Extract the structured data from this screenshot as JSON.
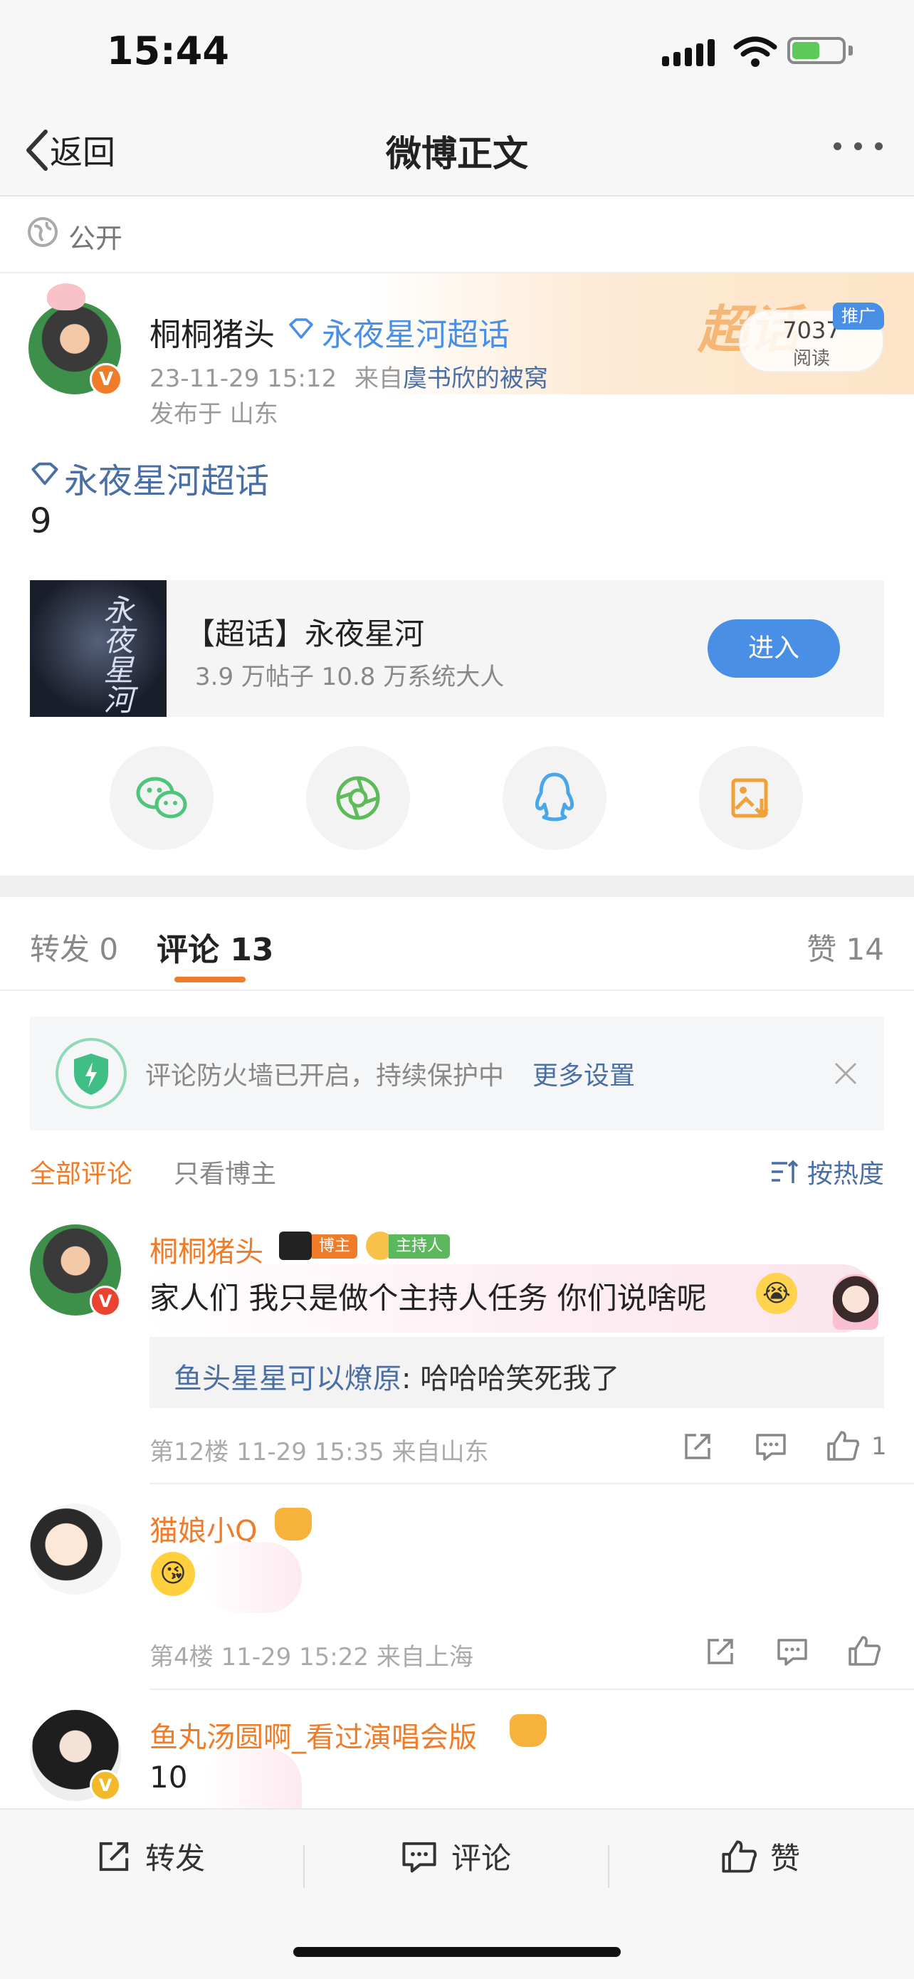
{
  "status_bar": {
    "time": "15:44"
  },
  "nav": {
    "back_label": "返回",
    "title": "微博正文"
  },
  "visibility": {
    "label": "公开"
  },
  "post": {
    "author": "桐桐猪头",
    "topic_tag": "永夜星河超话",
    "datetime": "23-11-29 15:12",
    "source_prefix": "来自",
    "source": "虞书欣的被窝",
    "location": "发布于 山东",
    "read_count": "7037",
    "read_label": "阅读",
    "promo_badge": "推广",
    "body_tag": "永夜星河超话",
    "body_text": "9"
  },
  "supertopic_card": {
    "title": "【超话】永夜星河",
    "stats": "3.9 万帖子 10.8 万系统大人",
    "enter_label": "进入",
    "cover_text": "永夜星河"
  },
  "share_buttons": [
    {
      "icon": "wechat-icon",
      "color": "#4fc47a"
    },
    {
      "icon": "moments-icon",
      "color": "#5dbb5a"
    },
    {
      "icon": "qq-icon",
      "color": "#49a6e8"
    },
    {
      "icon": "save-image-icon",
      "color": "#f0a23a"
    }
  ],
  "tabs": {
    "repost": "转发 0",
    "comment": "评论 13",
    "like": "赞 14"
  },
  "firewall": {
    "text": "评论防火墙已开启，持续保护中",
    "link": "更多设置"
  },
  "filters": {
    "all": "全部评论",
    "author_only": "只看博主",
    "sort": "按热度"
  },
  "comments": [
    {
      "name": "桐桐猪头",
      "badges": [
        "博主",
        "主持人"
      ],
      "text": "家人们 我只是做个主持人任务 你们说啥呢",
      "reply_user": "鱼头星星可以燎原",
      "reply_text": ": 哈哈哈笑死我了",
      "meta": "第12楼 11-29 15:35 来自山东",
      "likes": "1"
    },
    {
      "name": "猫娘小Q",
      "text": "",
      "meta": "第4楼 11-29 15:22 来自上海",
      "likes": ""
    },
    {
      "name": "鱼丸汤圆啊_看过演唱会版",
      "text": "10",
      "meta": "",
      "likes": ""
    }
  ],
  "bottom_bar": {
    "repost": "转发",
    "comment": "评论",
    "like": "赞"
  },
  "colors": {
    "accent_orange": "#f07c2a",
    "link_blue": "#4a6fa5",
    "button_blue": "#4a8fe6"
  }
}
